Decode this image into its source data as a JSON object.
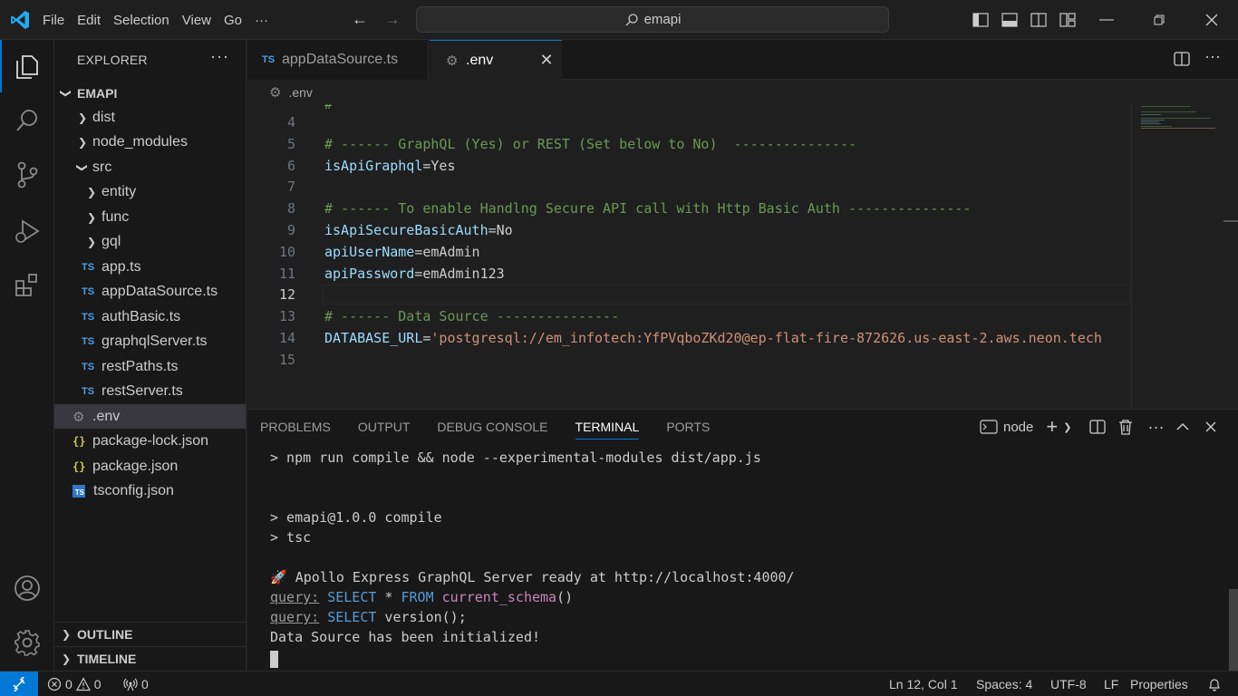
{
  "titlebar": {
    "menu": [
      "File",
      "Edit",
      "Selection",
      "View",
      "Go"
    ],
    "more_label": "···",
    "search_text": "emapi"
  },
  "explorer": {
    "title": "EXPLORER",
    "root": "EMAPI",
    "items": [
      {
        "label": "dist",
        "kind": "folder"
      },
      {
        "label": "node_modules",
        "kind": "folder"
      },
      {
        "label": "src",
        "kind": "folder-open"
      },
      {
        "label": "entity",
        "kind": "folder"
      },
      {
        "label": "func",
        "kind": "folder"
      },
      {
        "label": "gql",
        "kind": "folder"
      },
      {
        "label": "app.ts",
        "kind": "ts"
      },
      {
        "label": "appDataSource.ts",
        "kind": "ts"
      },
      {
        "label": "authBasic.ts",
        "kind": "ts"
      },
      {
        "label": "graphqlServer.ts",
        "kind": "ts"
      },
      {
        "label": "restPaths.ts",
        "kind": "ts"
      },
      {
        "label": "restServer.ts",
        "kind": "ts"
      },
      {
        "label": ".env",
        "kind": "env"
      },
      {
        "label": "package-lock.json",
        "kind": "json"
      },
      {
        "label": "package.json",
        "kind": "json"
      },
      {
        "label": "tsconfig.json",
        "kind": "tsconfig"
      }
    ],
    "ts_badge": "TS",
    "json_badge": "{}",
    "outline": "OUTLINE",
    "timeline": "TIMELINE"
  },
  "tabs": {
    "inactive": "appDataSource.ts",
    "active": ".env"
  },
  "breadcrumb": ".env",
  "editor": {
    "lines": [
      {
        "n": "4",
        "parts": []
      },
      {
        "n": "5",
        "parts": [
          {
            "t": "# ------ GraphQL (Yes) or REST (Set below to No)  ---------------",
            "c": "c-comment"
          }
        ]
      },
      {
        "n": "6",
        "parts": [
          {
            "t": "isApiGraphql",
            "c": "c-key"
          },
          {
            "t": "=Yes",
            "c": ""
          }
        ]
      },
      {
        "n": "7",
        "parts": []
      },
      {
        "n": "8",
        "parts": [
          {
            "t": "# ------ To enable Handlng Secure API call with Http Basic Auth ---------------",
            "c": "c-comment"
          }
        ]
      },
      {
        "n": "9",
        "parts": [
          {
            "t": "isApiSecureBasicAuth",
            "c": "c-key"
          },
          {
            "t": "=No",
            "c": ""
          }
        ]
      },
      {
        "n": "10",
        "parts": [
          {
            "t": "apiUserName",
            "c": "c-key"
          },
          {
            "t": "=emAdmin",
            "c": ""
          }
        ]
      },
      {
        "n": "11",
        "parts": [
          {
            "t": "apiPassword",
            "c": "c-key"
          },
          {
            "t": "=emAdmin123",
            "c": ""
          }
        ]
      },
      {
        "n": "12",
        "parts": []
      },
      {
        "n": "13",
        "parts": [
          {
            "t": "# ------ Data Source ---------------",
            "c": "c-comment"
          }
        ]
      },
      {
        "n": "14",
        "parts": [
          {
            "t": "DATABASE_URL",
            "c": "c-key"
          },
          {
            "t": "=",
            "c": ""
          },
          {
            "t": "'postgresql://em_infotech:YfPVqboZKd20@ep-flat-fire-872626.us-east-2.aws.neon.tech",
            "c": "c-str"
          }
        ]
      },
      {
        "n": "15",
        "parts": []
      }
    ],
    "current_line": "12"
  },
  "panel": {
    "tabs": [
      "PROBLEMS",
      "OUTPUT",
      "DEBUG CONSOLE",
      "TERMINAL",
      "PORTS"
    ],
    "active_tab": "TERMINAL",
    "terminal_name": "node",
    "terminal_lines": [
      [
        {
          "t": "> npm run compile && node --experimental-modules dist/app.js",
          "c": ""
        }
      ],
      [],
      [],
      [
        {
          "t": "> emapi@1.0.0 compile",
          "c": ""
        }
      ],
      [
        {
          "t": "> tsc",
          "c": ""
        }
      ],
      [],
      [
        {
          "t": "🚀 Apollo Express GraphQL Server ready at http://localhost:4000/",
          "c": ""
        }
      ],
      [
        {
          "t": "query:",
          "c": "t-dim"
        },
        {
          "t": " ",
          "c": ""
        },
        {
          "t": "SELECT",
          "c": "t-blue"
        },
        {
          "t": " * ",
          "c": ""
        },
        {
          "t": "FROM",
          "c": "t-blue"
        },
        {
          "t": " ",
          "c": ""
        },
        {
          "t": "current_schema",
          "c": "t-mag"
        },
        {
          "t": "()",
          "c": ""
        }
      ],
      [
        {
          "t": "query:",
          "c": "t-dim"
        },
        {
          "t": " ",
          "c": ""
        },
        {
          "t": "SELECT",
          "c": "t-blue"
        },
        {
          "t": " version();",
          "c": ""
        }
      ],
      [
        {
          "t": "Data Source has been initialized!",
          "c": ""
        }
      ]
    ]
  },
  "status": {
    "errors": "0",
    "warnings": "0",
    "ports": "0",
    "position": "Ln 12, Col 1",
    "spaces": "Spaces: 4",
    "encoding": "UTF-8",
    "eol": "LF",
    "language": "Properties"
  },
  "colors": {
    "accent": "#0078d4",
    "comment": "#6a9955",
    "key": "#9cdcfe",
    "string": "#ce9178"
  }
}
